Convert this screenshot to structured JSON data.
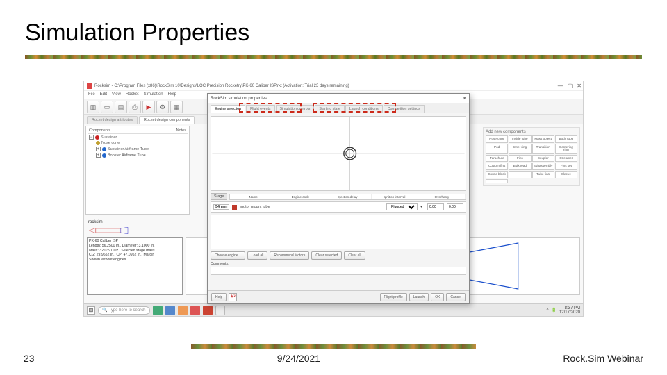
{
  "slide": {
    "title": "Simulation Properties",
    "page_number": "23",
    "date": "9/24/2021",
    "footer_label": "Rock.Sim Webinar"
  },
  "main_window": {
    "title": "Rocksim - C:\\Program Files (x86)\\RockSim 10\\Designs\\LOC Precision Rocketry\\PK-60 Caliber ISP.rkt (Activation: Trial 23 days remaining)",
    "menu": [
      "File",
      "Edit",
      "View",
      "Rocket",
      "Simulation",
      "Help"
    ],
    "tabs": {
      "design_attrs": "Rocket design attributes",
      "design_components": "Rocket design components"
    },
    "tree_head": {
      "col1": "Components",
      "col2": "Notes"
    },
    "tree": [
      {
        "label": "Sustainer",
        "color": "#cc2222"
      },
      {
        "label": "Nose cone",
        "color": "#c0a030",
        "indent": 1
      },
      {
        "label": "Sustainer Airframe Tube",
        "color": "#2266cc",
        "indent": 1
      },
      {
        "label": "Booster Airframe Tube",
        "color": "#2266cc",
        "indent": 1
      }
    ],
    "add_panel": {
      "title": "Add new components",
      "cells": [
        "Nose cone",
        "Inside tube",
        "Mass object",
        "Body tube",
        "Pod",
        "Inner ring",
        "Transition",
        "Centering ring",
        "Parachute",
        "Fins",
        "Coupler",
        "Streamer",
        "Custom fins",
        "Bulkhead",
        "Subassembly",
        "Fins set",
        "Sound block",
        "",
        "Tube fins",
        "Sleeve",
        ""
      ]
    },
    "rocksim_label": "rocksim",
    "info_box": "PK-60 Caliber ISP\nLength: 56.2500 In., Diameter: 3.1000 In.\nMass: 32.0391 Oz., Selected stage mass\nCG: 29.9652 In., CP: 47.0952 In., Margin\nShown without engines.",
    "taskbar": {
      "search_placeholder": "Type here to search",
      "clock_time": "8:37 PM",
      "clock_date": "12/17/2020"
    }
  },
  "dialog": {
    "title": "RockSim simulation properties...",
    "tabs": [
      "Engine selection",
      "Flight events",
      "Simulation controls",
      "Starting state",
      "Launch conditions",
      "Competition settings"
    ],
    "active_tab_index": 0,
    "stage_header": "Stage",
    "stage_cols": [
      "Name",
      "Engine code",
      "Ejection delay",
      "Ignition interval",
      "Overhang"
    ],
    "mount_row": {
      "badge": "54 mm",
      "label": "motor mount tube",
      "plugged": "Plugged",
      "val1": "0.00",
      "val2": "0.00"
    },
    "buttons_row": [
      "Choose engine...",
      "Load all",
      "Recommend Motors",
      "Clear selected",
      "Clear all"
    ],
    "comments_label": "Comments:",
    "footer": {
      "help": "Help",
      "flight_profile": "Flight profile",
      "launch": "Launch",
      "ok": "OK",
      "cancel": "Cancel"
    }
  }
}
